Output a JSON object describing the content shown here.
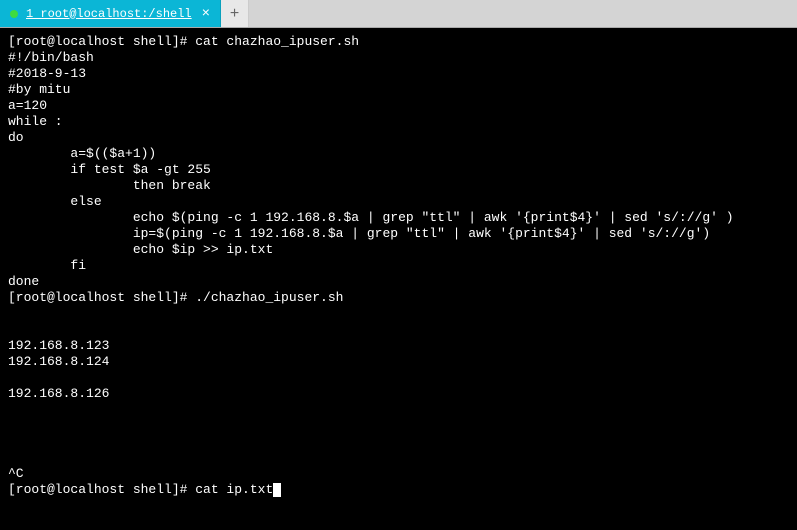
{
  "tab": {
    "title": "1 root@localhost:/shell"
  },
  "terminal": {
    "lines": [
      "[root@localhost shell]# cat chazhao_ipuser.sh",
      "#!/bin/bash",
      "#2018-9-13",
      "#by mitu",
      "a=120",
      "while :",
      "do",
      "        a=$(($a+1))",
      "        if test $a -gt 255",
      "                then break",
      "        else",
      "                echo $(ping -c 1 192.168.8.$a | grep \"ttl\" | awk '{print$4}' | sed 's/://g' )",
      "                ip=$(ping -c 1 192.168.8.$a | grep \"ttl\" | awk '{print$4}' | sed 's/://g')",
      "                echo $ip >> ip.txt",
      "        fi",
      "done",
      "[root@localhost shell]# ./chazhao_ipuser.sh",
      "",
      "",
      "192.168.8.123",
      "192.168.8.124",
      "",
      "192.168.8.126",
      "",
      "",
      "",
      "",
      "^C",
      "[root@localhost shell]# cat ip.txt"
    ]
  }
}
